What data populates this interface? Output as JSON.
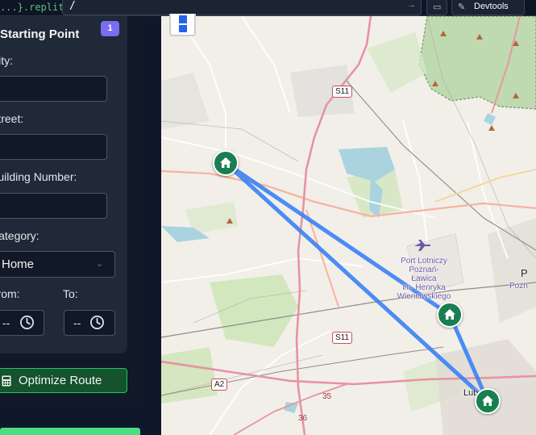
{
  "browser": {
    "domain": "...}.replit.dev",
    "url_path": "/",
    "devtools_label": "Devtools"
  },
  "panel": {
    "card_title": "Starting Point",
    "badge": "1",
    "city_label": "City:",
    "street_label": "Street:",
    "building_label": "Building Number:",
    "category_label": "Category:",
    "category_value": "Home",
    "from_label": "From:",
    "to_label": "To:",
    "from_value": "--",
    "to_value": "--",
    "optimize_label": "Optimize Route"
  },
  "map": {
    "road_shields": [
      "S11",
      "S11",
      "A2"
    ],
    "route_numbers": [
      "35",
      "36"
    ],
    "airport_label": [
      "Port Lotniczy",
      "Poznań-",
      "Ławica",
      "im. Henryka",
      "Wieniawskiego"
    ],
    "city_partial": "Lub",
    "edge_labels": [
      "P",
      "Pozn"
    ],
    "markers": [
      "home-icon",
      "home-icon",
      "home-icon"
    ],
    "colors": {
      "route": "#3b82f6",
      "marker": "#1a7f4f",
      "motorway": "#e892a2",
      "trunk": "#f9b29c"
    }
  }
}
